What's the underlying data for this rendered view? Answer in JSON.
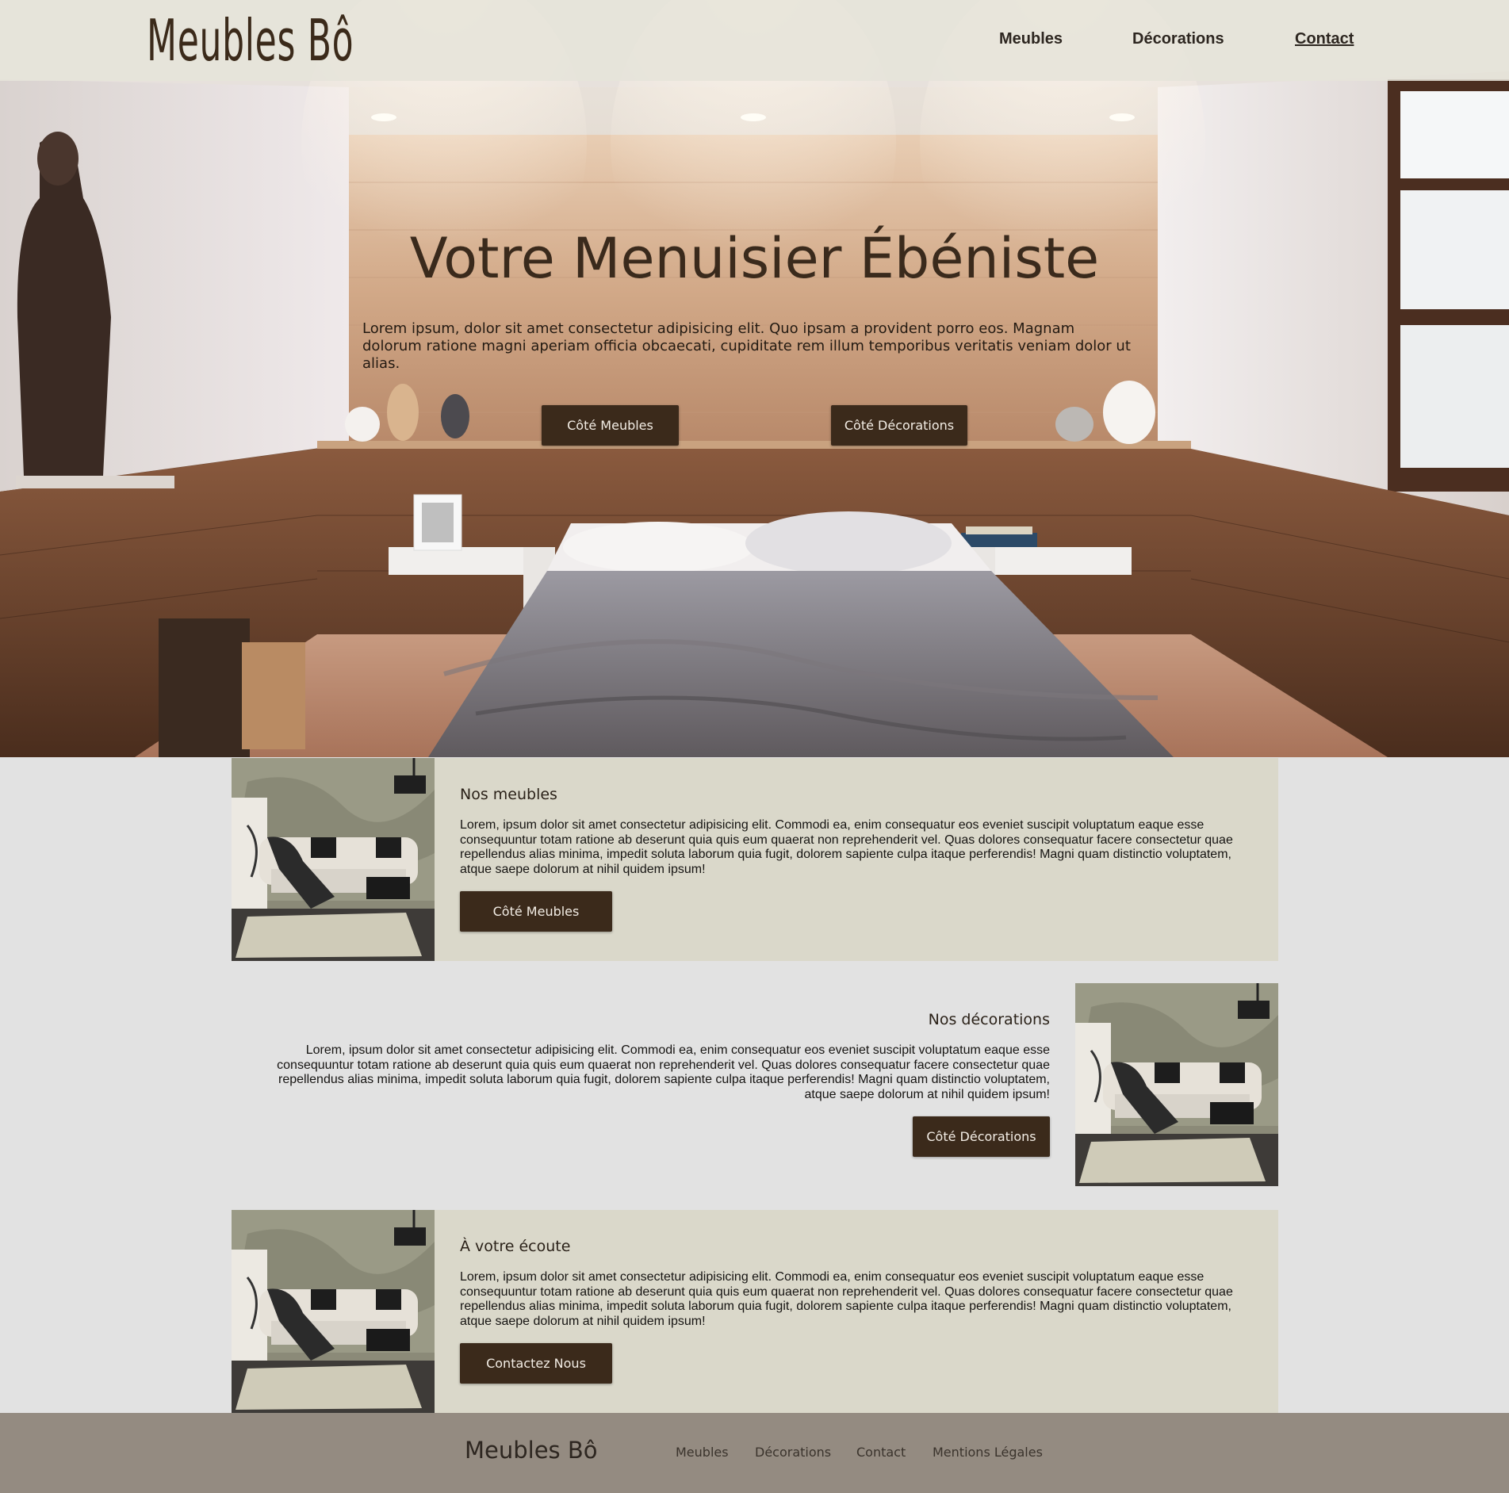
{
  "header": {
    "logo": "Meubles Bô",
    "nav": [
      {
        "label": "Meubles"
      },
      {
        "label": "Décorations"
      },
      {
        "label": "Contact"
      }
    ]
  },
  "hero": {
    "title": "Votre Menuisier Ébéniste",
    "text": "Lorem ipsum, dolor sit amet consectetur adipisicing elit. Quo ipsam a provident porro eos. Magnam dolorum ratione magni aperiam officia obcaecati, cupiditate rem illum temporibus veritatis veniam dolor ut alias.",
    "buttons": [
      {
        "label": "Côté Meubles"
      },
      {
        "label": "Côté Décorations"
      }
    ]
  },
  "sections": [
    {
      "title": "Nos meubles",
      "text": "Lorem, ipsum dolor sit amet consectetur adipisicing elit. Commodi ea, enim consequatur eos eveniet suscipit voluptatum eaque esse consequuntur totam ratione ab deserunt quia quis eum quaerat non reprehenderit vel. Quas dolores consequatur facere consectetur quae repellendus alias minima, impedit soluta laborum quia fugit, dolorem sapiente culpa itaque perferendis! Magni quam distinctio voluptatem, atque saepe dolorum at nihil quidem ipsum!",
      "button": "Côté Meubles"
    },
    {
      "title": "Nos décorations",
      "text": "Lorem, ipsum dolor sit amet consectetur adipisicing elit. Commodi ea, enim consequatur eos eveniet suscipit voluptatum eaque esse consequuntur totam ratione ab deserunt quia quis eum quaerat non reprehenderit vel. Quas dolores consequatur facere consectetur quae repellendus alias minima, impedit soluta laborum quia fugit, dolorem sapiente culpa itaque perferendis! Magni quam distinctio voluptatem, atque saepe dolorum at nihil quidem ipsum!",
      "button": "Côté Décorations"
    },
    {
      "title": "À votre écoute",
      "text": "Lorem, ipsum dolor sit amet consectetur adipisicing elit. Commodi ea, enim consequatur eos eveniet suscipit voluptatum eaque esse consequuntur totam ratione ab deserunt quia quis eum quaerat non reprehenderit vel. Quas dolores consequatur facere consectetur quae repellendus alias minima, impedit soluta laborum quia fugit, dolorem sapiente culpa itaque perferendis! Magni quam distinctio voluptatem, atque saepe dolorum at nihil quidem ipsum!",
      "button": "Contactez Nous"
    }
  ],
  "footer": {
    "logo": "Meubles Bô",
    "links": [
      {
        "label": "Meubles"
      },
      {
        "label": "Décorations"
      },
      {
        "label": "Contact"
      },
      {
        "label": "Mentions Légales"
      }
    ]
  },
  "colors": {
    "brown_button": "#3b2a1b",
    "beige_panel": "#dad8ca",
    "page_bg": "#e2e2e2",
    "footer_bg": "#948b81",
    "header_bg": "#e6e4da"
  }
}
